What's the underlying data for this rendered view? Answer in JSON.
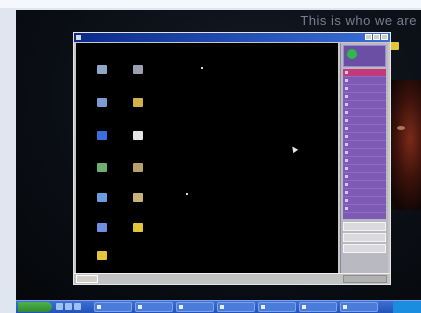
{
  "host": {
    "wallpaper_text": "This is who we are",
    "right_icon": {
      "icon": "folder-icon",
      "color": "#e4c43a"
    },
    "taskbar": {
      "start_label": "",
      "quick_launch": [
        "ie-icon",
        "desktop-icon",
        "media-icon"
      ],
      "tasks": [
        {
          "label": ""
        },
        {
          "label": ""
        },
        {
          "label": ""
        },
        {
          "label": ""
        },
        {
          "label": ""
        },
        {
          "label": ""
        },
        {
          "label": ""
        }
      ],
      "tray": ""
    },
    "caption": ""
  },
  "remote": {
    "window_title": "",
    "desktop_icons": [
      {
        "label": "",
        "icon": "my-computer-icon",
        "color": "#8fa6c8"
      },
      {
        "label": "",
        "icon": "user-icon",
        "color": "#9aa0b0"
      },
      {
        "label": "",
        "icon": "network-icon",
        "color": "#7e9ad0"
      },
      {
        "label": "",
        "icon": "tools-icon",
        "color": "#d1b24a"
      },
      {
        "label": "",
        "icon": "ie-icon",
        "color": "#3a6fe0"
      },
      {
        "label": "",
        "icon": "document-icon",
        "color": "#e5e5e5"
      },
      {
        "label": "",
        "icon": "recycle-icon",
        "color": "#6fb070"
      },
      {
        "label": "",
        "icon": "app-icon",
        "color": "#b7a36a"
      },
      {
        "label": "",
        "icon": "outlook-icon",
        "color": "#6a9de0"
      },
      {
        "label": "",
        "icon": "archive-icon",
        "color": "#c8b27a"
      },
      {
        "label": "",
        "icon": "shortcut-icon",
        "color": "#6f8fe0"
      },
      {
        "label": "",
        "icon": "folder-icon",
        "color": "#e4c43a"
      },
      {
        "label": "",
        "icon": "folder-icon",
        "color": "#e4c43a"
      }
    ],
    "side_panel": {
      "header": "",
      "items": [
        {
          "label": ""
        },
        {
          "label": ""
        },
        {
          "label": ""
        },
        {
          "label": ""
        },
        {
          "label": ""
        },
        {
          "label": ""
        },
        {
          "label": ""
        },
        {
          "label": ""
        },
        {
          "label": ""
        },
        {
          "label": ""
        },
        {
          "label": ""
        },
        {
          "label": ""
        },
        {
          "label": ""
        },
        {
          "label": ""
        },
        {
          "label": ""
        },
        {
          "label": ""
        },
        {
          "label": ""
        },
        {
          "label": ""
        }
      ],
      "buttons": [
        {
          "label": ""
        },
        {
          "label": ""
        },
        {
          "label": ""
        }
      ]
    },
    "taskbar": {
      "start_label": ""
    }
  }
}
